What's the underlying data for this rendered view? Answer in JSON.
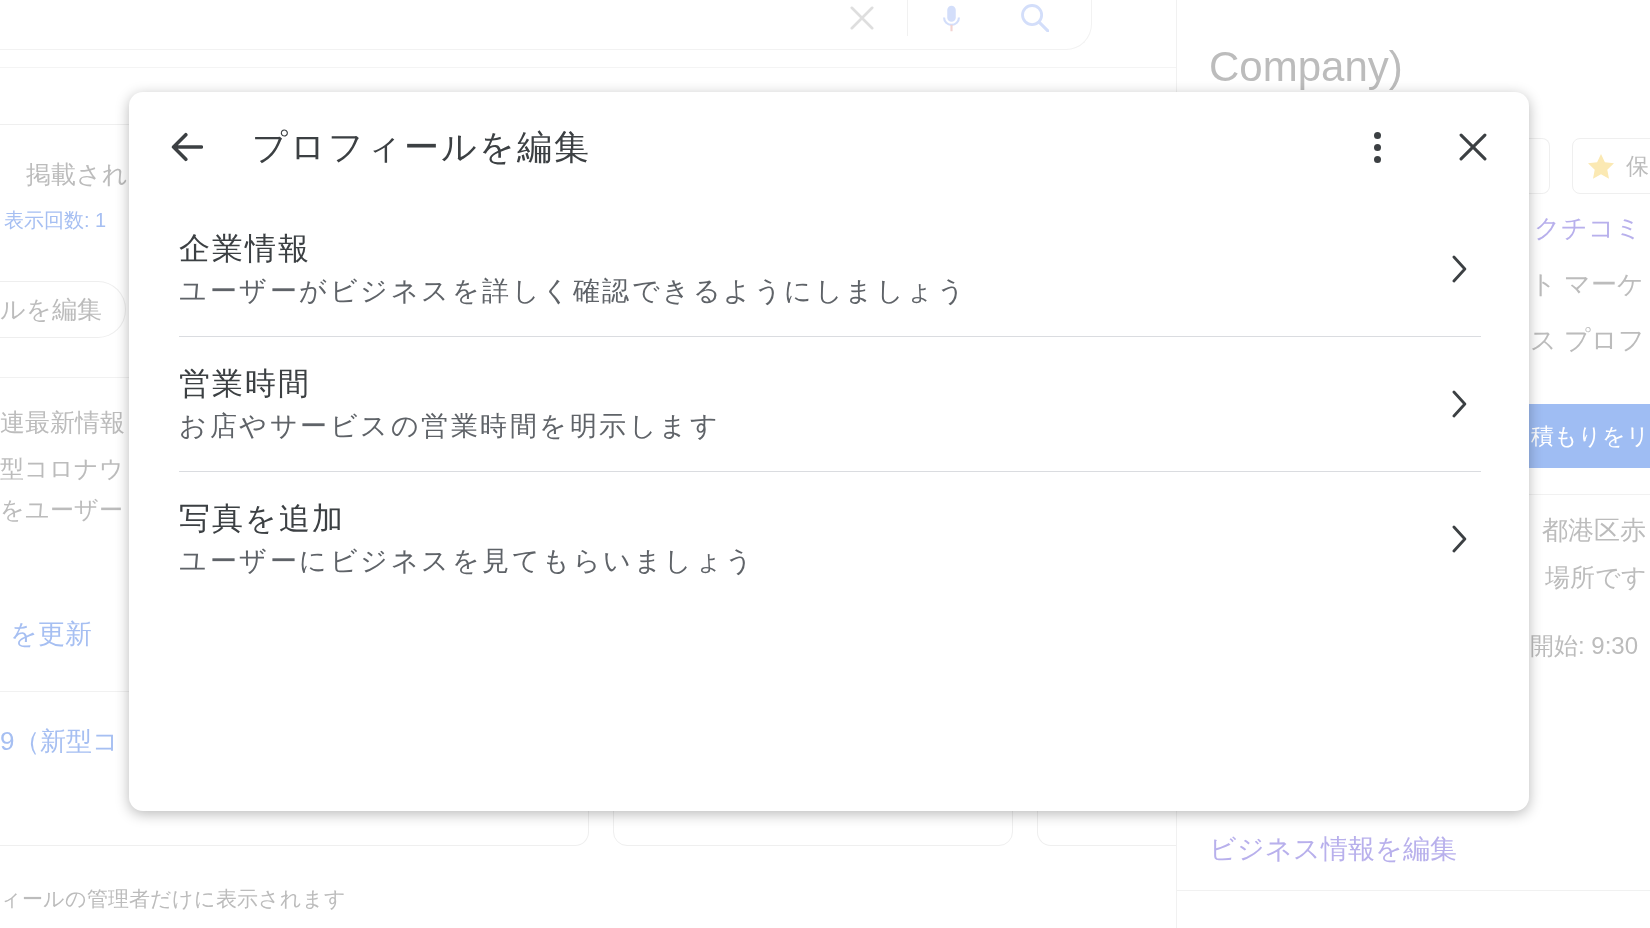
{
  "background": {
    "left_card": {
      "listing_text": "掲載され",
      "views_link": "表示回数: 1",
      "edit_button": "ルを編集",
      "post_title": "連最新情報",
      "post_lines": [
        "型コロナウ",
        "をユーザー"
      ],
      "update_link": "を更新",
      "post_link": "9（新型コ"
    },
    "footer_note": "ィールの管理者だけに表示されます",
    "right_panel": {
      "title": "Company)",
      "chip": "保",
      "reviews_link": "クチコミ",
      "lines": [
        "ト マーケ",
        "ス プロフ"
      ],
      "quote_button": "積もりをリ",
      "address_lines": [
        "都港区赤",
        "場所です"
      ],
      "hours": "開始: 9:30",
      "edit_link": "ビジネス情報を編集"
    }
  },
  "dialog": {
    "title": "プロフィールを編集",
    "items": [
      {
        "title": "企業情報",
        "description": "ユーザーがビジネスを詳しく確認できるようにしましょう"
      },
      {
        "title": "営業時間",
        "description": "お店やサービスの営業時間を明示します"
      },
      {
        "title": "写真を追加",
        "description": "ユーザーにビジネスを見てもらいましょう"
      }
    ]
  }
}
